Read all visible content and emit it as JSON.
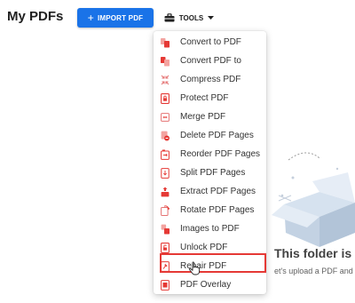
{
  "header": {
    "title": "My PDFs",
    "import_label": "IMPORT PDF",
    "tools_label": "TOOLS"
  },
  "tools_menu": {
    "items": [
      {
        "label": "Convert to PDF",
        "icon": "convert-to-pdf-icon"
      },
      {
        "label": "Convert PDF to",
        "icon": "convert-pdf-to-icon"
      },
      {
        "label": "Compress PDF",
        "icon": "compress-icon"
      },
      {
        "label": "Protect PDF",
        "icon": "protect-icon"
      },
      {
        "label": "Merge PDF",
        "icon": "merge-icon"
      },
      {
        "label": "Delete PDF Pages",
        "icon": "delete-pages-icon"
      },
      {
        "label": "Reorder PDF Pages",
        "icon": "reorder-pages-icon"
      },
      {
        "label": "Split PDF Pages",
        "icon": "split-pages-icon"
      },
      {
        "label": "Extract PDF Pages",
        "icon": "extract-pages-icon"
      },
      {
        "label": "Rotate PDF Pages",
        "icon": "rotate-pages-icon"
      },
      {
        "label": "Images to PDF",
        "icon": "images-to-pdf-icon"
      },
      {
        "label": "Unlock PDF",
        "icon": "unlock-icon"
      },
      {
        "label": "Repair PDF",
        "icon": "repair-icon"
      },
      {
        "label": "PDF Overlay",
        "icon": "overlay-icon"
      }
    ],
    "highlighted_item": "Repair PDF"
  },
  "empty_state": {
    "title": "This folder is",
    "subtitle": "et's upload a PDF and"
  },
  "colors": {
    "accent": "#1a73e8",
    "icon_red": "#e53935",
    "highlight_border": "#e53935"
  }
}
